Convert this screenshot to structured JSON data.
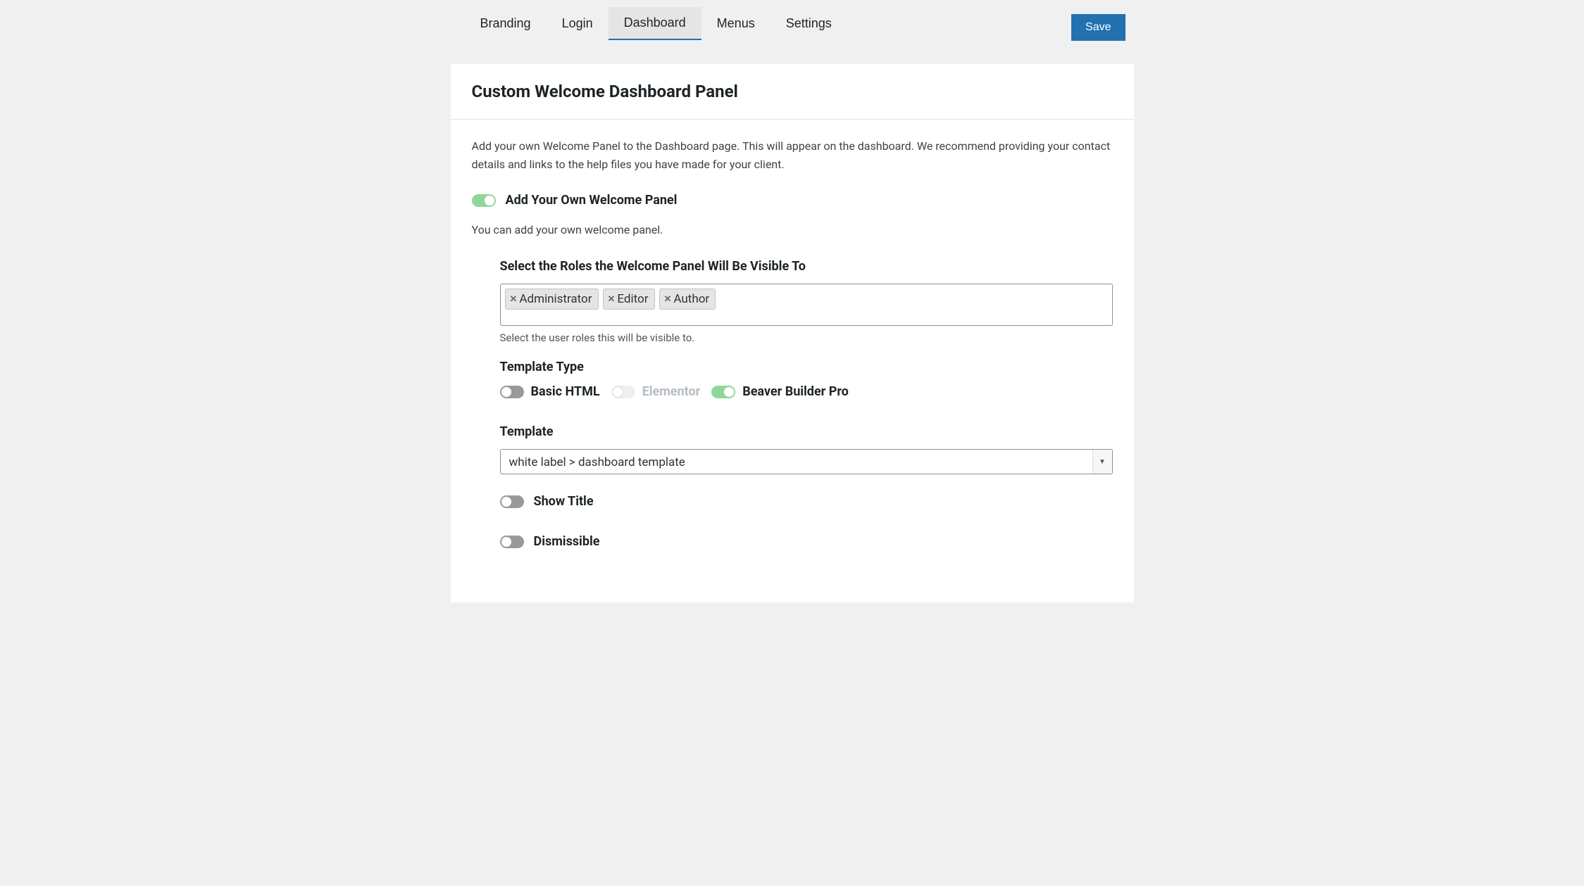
{
  "tabs": {
    "branding": "Branding",
    "login": "Login",
    "dashboard": "Dashboard",
    "menus": "Menus",
    "settings": "Settings"
  },
  "save_label": "Save",
  "panel": {
    "title": "Custom Welcome Dashboard Panel",
    "description": "Add your own Welcome Panel to the Dashboard page. This will appear on the dashboard. We recommend providing your contact details and links to the help files you have made for your client.",
    "main_toggle_label": "Add Your Own Welcome Panel",
    "sub_desc": "You can add your own welcome panel."
  },
  "roles": {
    "label": "Select the Roles the Welcome Panel Will Be Visible To",
    "items": [
      "Administrator",
      "Editor",
      "Author"
    ],
    "help": "Select the user roles this will be visible to."
  },
  "template_type": {
    "label": "Template Type",
    "options": {
      "basic_html": "Basic HTML",
      "elementor": "Elementor",
      "beaver": "Beaver Builder Pro"
    }
  },
  "template": {
    "label": "Template",
    "selected": "white label > dashboard template"
  },
  "show_title_label": "Show Title",
  "dismissible_label": "Dismissible"
}
